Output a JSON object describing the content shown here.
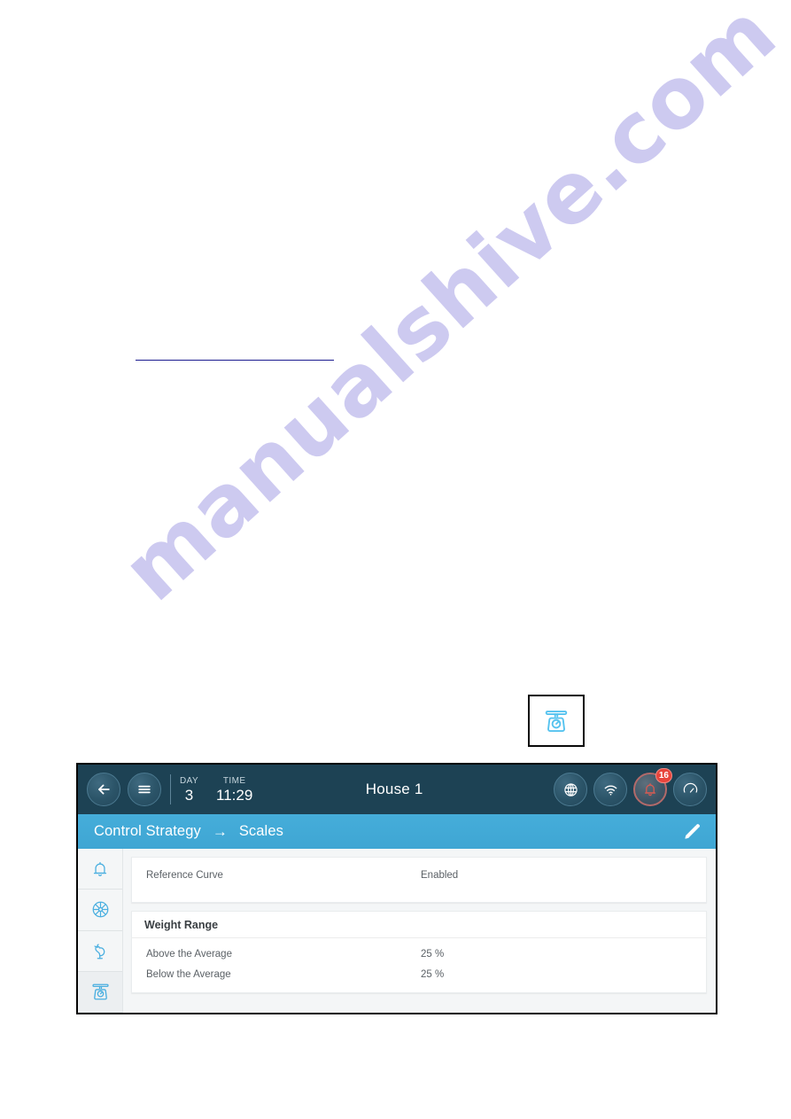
{
  "page": {
    "watermark": "manualshive.com"
  },
  "standalone_icon": {
    "name": "scales-icon"
  },
  "device": {
    "topbar": {
      "back_icon": "arrow-left-icon",
      "menu_icon": "hamburger-menu-icon",
      "day_label": "DAY",
      "day_value": "3",
      "time_label": "TIME",
      "time_value": "11:29",
      "house_title": "House 1",
      "globe_icon": "globe-icon",
      "wifi_icon": "wifi-icon",
      "alarm_icon": "alarm-bell-icon",
      "alarm_badge": "16",
      "system_icon": "gauge-icon",
      "bg_color": "#1d4254",
      "alarm_ring_color": "#b26a6a",
      "badge_color": "#e8453c"
    },
    "breadcrumb": {
      "parent": "Control Strategy",
      "arrow": "→",
      "current": "Scales",
      "edit_icon": "pencil-edit-icon",
      "bg_color": "#42a8d8"
    },
    "sidebar": {
      "items": [
        {
          "icon": "alarm-bell-icon",
          "name": "alarm"
        },
        {
          "icon": "fan-icon",
          "name": "ventilation"
        },
        {
          "icon": "rooster-icon",
          "name": "birds"
        },
        {
          "icon": "scales-icon",
          "name": "scales"
        }
      ]
    },
    "content": {
      "settings_card": {
        "rows": [
          {
            "label": "Reference Curve",
            "value": "Enabled"
          }
        ]
      },
      "weight_range_card": {
        "title": "Weight Range",
        "rows": [
          {
            "label": "Above the Average",
            "value": "25 %"
          },
          {
            "label": "Below the Average",
            "value": "25 %"
          }
        ]
      }
    }
  }
}
